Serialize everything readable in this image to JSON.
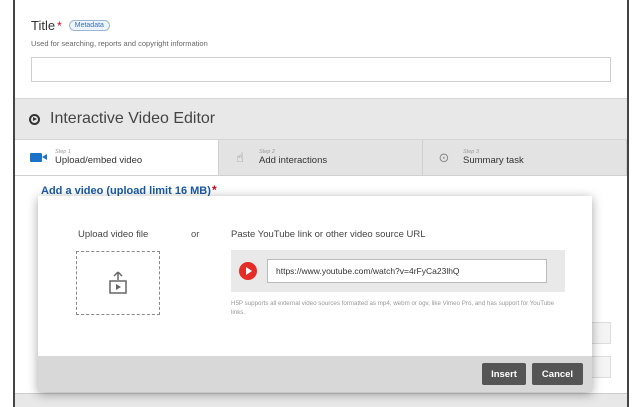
{
  "title_field": {
    "label": "Title",
    "required_mark": "*",
    "badge": "Metadata",
    "description": "Used for searching, reports and copyright information",
    "value": ""
  },
  "editor": {
    "heading": "Interactive Video Editor",
    "steps": [
      {
        "number": "Step 1",
        "label": "Upload/embed video",
        "icon": "video-camera-icon",
        "active": true
      },
      {
        "number": "Step 2",
        "label": "Add interactions",
        "icon": "hand-pointer-icon",
        "active": false
      },
      {
        "number": "Step 3",
        "label": "Summary task",
        "icon": "check-circle-icon",
        "active": false
      }
    ],
    "add_video_label": "Add a video (upload limit 16 MB)",
    "add_video_required": "*"
  },
  "dialog": {
    "upload_label": "Upload video file",
    "or_text": "or",
    "paste_label": "Paste YouTube link or other video source URL",
    "url_value": "https://www.youtube.com/watch?v=4rFyCa23lhQ",
    "help_text": "H5P supports all external video sources formatted as mp4, webm or ogv, like Vimeo Pro, and has support for YouTube links.",
    "insert_label": "Insert",
    "cancel_label": "Cancel"
  },
  "colors": {
    "accent": "#1a73c9",
    "required": "#d0021b",
    "youtube": "#e52d27",
    "button": "#555555"
  }
}
